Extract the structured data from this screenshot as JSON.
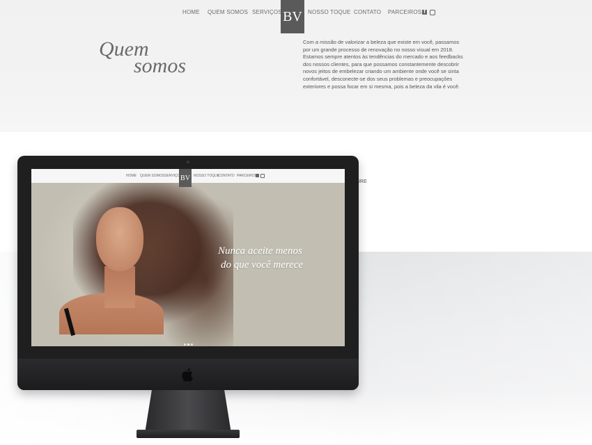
{
  "nav": {
    "items": [
      "HOME",
      "QUEM SOMOS",
      "SERVIÇOS",
      "NOSSO TOQUE",
      "CONTATO",
      "PARCEIROS"
    ],
    "logo": "BV",
    "social": [
      "facebook-icon",
      "instagram-icon"
    ]
  },
  "about": {
    "title_line1": "Quem",
    "title_line2": "somos",
    "paragraph": "Com a missão de valorizar a beleza que existe em você, passamos por um grande processo de renovação no nosso visual em 2018. Estamos sempre atentos às tendências do mercado e aos feedbacks dos nossos clientes, para que possamos constantemente descobrir novos jeitos de embelezar criando um ambiente onde você se sinta confortável, desconecte-se dos seus problemas e preocupações exteriores e possa focar em si mesma, pois a beleza da vila é você."
  },
  "services_partial": "ICURE",
  "monitor": {
    "nav_items": [
      "HOME",
      "QUEM SOMOS",
      "SERVIÇOS",
      "NOSSO TOQUE",
      "CONTATO",
      "PARCEIROS"
    ],
    "logo": "BV",
    "hero_line1": "Nunca aceite menos",
    "hero_line2": "do que você merece",
    "slide_count": 3
  },
  "colors": {
    "logo_bg": "#5a5a5a",
    "text": "#6b6b6b"
  }
}
